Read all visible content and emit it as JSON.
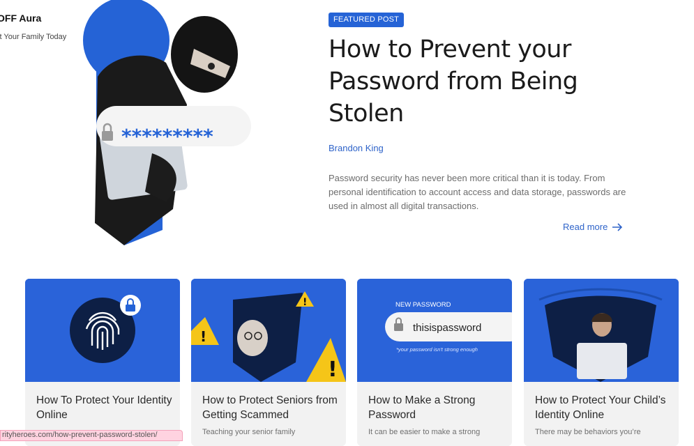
{
  "promo": {
    "title": "OFF Aura",
    "subtitle": "ct Your Family Today"
  },
  "featured": {
    "badge": "FEATURED POST",
    "title": "How to Prevent your Password from Being Stolen",
    "author": "Brandon King",
    "excerpt": "Password security has never been more critical than it is today. From personal identification to account access and data storage, passwords are used in almost all digital transactions.",
    "read_more": "Read more",
    "illustration_mask": "*********"
  },
  "cards": [
    {
      "title": "How To Protect Your Identity Online",
      "excerpt": "",
      "icon": "fingerprint-lock"
    },
    {
      "title": "How to Protect Seniors from Getting Scammed",
      "excerpt": "Teaching your senior family",
      "icon": "warning-signs"
    },
    {
      "title": "How to Make a Strong Password",
      "excerpt": "It can be easier to make a strong",
      "icon": "password-field",
      "img_label": "NEW PASSWORD",
      "img_value": "thisispassword",
      "img_hint": "*your password isn't strong enough"
    },
    {
      "title": "How to Protect Your Child’s Identity Online",
      "excerpt": "There may be behaviors you’re",
      "icon": "child-laptop"
    }
  ],
  "status_url": "rityheroes.com/how-prevent-password-stolen/",
  "colors": {
    "accent": "#2563d6",
    "card_blue": "#2a63d9",
    "navy": "#0d1f45",
    "warning": "#f5c518"
  }
}
